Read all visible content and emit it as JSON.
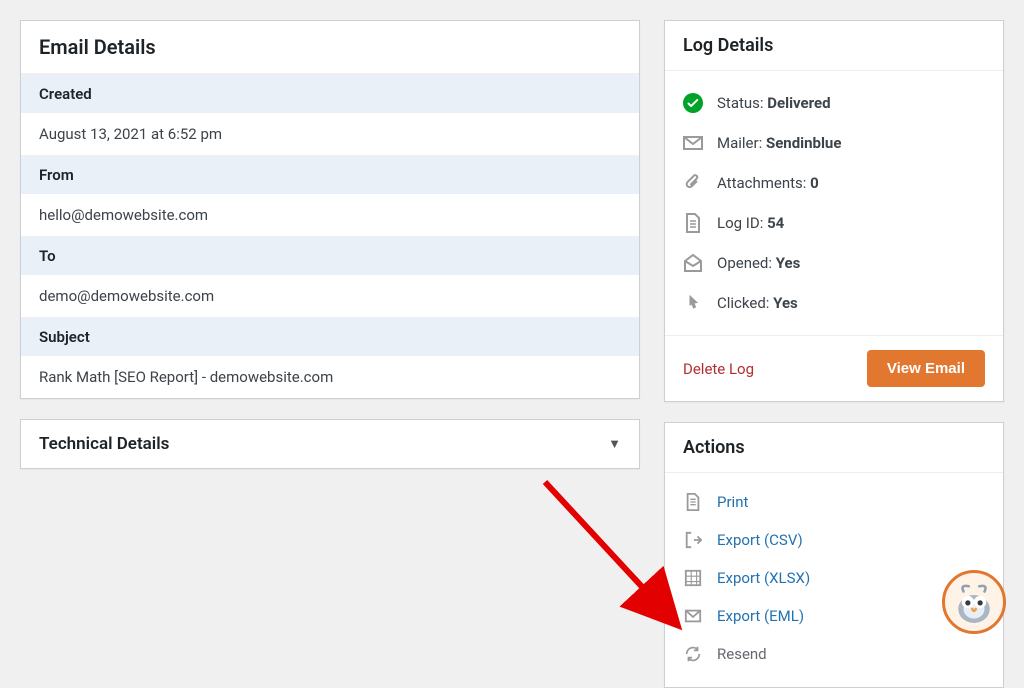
{
  "email_details": {
    "title": "Email Details",
    "created": {
      "label": "Created",
      "value": "August 13, 2021 at 6:52 pm"
    },
    "from": {
      "label": "From",
      "value": "hello@demowebsite.com"
    },
    "to": {
      "label": "To",
      "value": "demo@demowebsite.com"
    },
    "subject": {
      "label": "Subject",
      "value": "Rank Math [SEO Report] - demowebsite.com"
    }
  },
  "technical_details": {
    "title": "Technical Details"
  },
  "log_details": {
    "title": "Log Details",
    "status": {
      "label": "Status: ",
      "value": "Delivered"
    },
    "mailer": {
      "label": "Mailer: ",
      "value": "Sendinblue"
    },
    "attachments": {
      "label": "Attachments: ",
      "value": "0"
    },
    "log_id": {
      "label": "Log ID: ",
      "value": "54"
    },
    "opened": {
      "label": "Opened: ",
      "value": "Yes"
    },
    "clicked": {
      "label": "Clicked: ",
      "value": "Yes"
    },
    "delete": "Delete Log",
    "view": "View Email"
  },
  "actions": {
    "title": "Actions",
    "print": "Print",
    "export_csv": "Export (CSV)",
    "export_xlsx": "Export (XLSX)",
    "export_eml": "Export (EML)",
    "resend": "Resend"
  }
}
